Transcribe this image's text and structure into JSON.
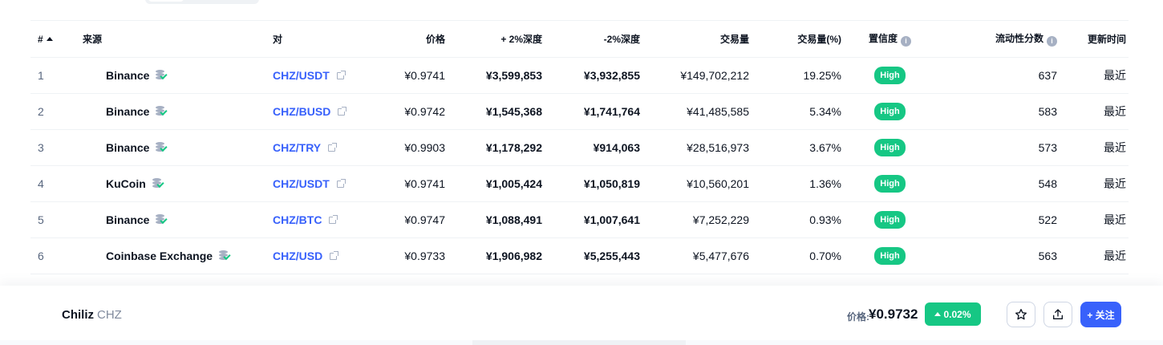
{
  "colors": {
    "accent": "#3861fb",
    "positive": "#16c784",
    "text_primary": "#0d1421",
    "text_secondary": "#58667e"
  },
  "table": {
    "headers": {
      "rank": "#",
      "source": "来源",
      "pair": "对",
      "price": "价格",
      "plus_depth": "+ 2%深度",
      "minus_depth": "-2%深度",
      "volume": "交易量",
      "volume_pct": "交易量(%)",
      "confidence": "置信度",
      "liquidity": "流动性分数",
      "updated": "更新时间"
    },
    "sort_icon": "sort-up-icon",
    "info_icon_glyph": "i",
    "rows": [
      {
        "rank": "1",
        "source": "Binance",
        "pair": "CHZ/USDT",
        "price": "¥0.9741",
        "plus_depth": "¥3,599,853",
        "minus_depth": "¥3,932,855",
        "volume": "¥149,702,212",
        "volume_pct": "19.25%",
        "confidence": "High",
        "liquidity": "637",
        "updated": "最近"
      },
      {
        "rank": "2",
        "source": "Binance",
        "pair": "CHZ/BUSD",
        "price": "¥0.9742",
        "plus_depth": "¥1,545,368",
        "minus_depth": "¥1,741,764",
        "volume": "¥41,485,585",
        "volume_pct": "5.34%",
        "confidence": "High",
        "liquidity": "583",
        "updated": "最近"
      },
      {
        "rank": "3",
        "source": "Binance",
        "pair": "CHZ/TRY",
        "price": "¥0.9903",
        "plus_depth": "¥1,178,292",
        "minus_depth": "¥914,063",
        "volume": "¥28,516,973",
        "volume_pct": "3.67%",
        "confidence": "High",
        "liquidity": "573",
        "updated": "最近"
      },
      {
        "rank": "4",
        "source": "KuCoin",
        "pair": "CHZ/USDT",
        "price": "¥0.9741",
        "plus_depth": "¥1,005,424",
        "minus_depth": "¥1,050,819",
        "volume": "¥10,560,201",
        "volume_pct": "1.36%",
        "confidence": "High",
        "liquidity": "548",
        "updated": "最近"
      },
      {
        "rank": "5",
        "source": "Binance",
        "pair": "CHZ/BTC",
        "price": "¥0.9747",
        "plus_depth": "¥1,088,491",
        "minus_depth": "¥1,007,641",
        "volume": "¥7,252,229",
        "volume_pct": "0.93%",
        "confidence": "High",
        "liquidity": "522",
        "updated": "最近"
      },
      {
        "rank": "6",
        "source": "Coinbase Exchange",
        "pair": "CHZ/USD",
        "price": "¥0.9733",
        "plus_depth": "¥1,906,982",
        "minus_depth": "¥5,255,443",
        "volume": "¥5,477,676",
        "volume_pct": "0.70%",
        "confidence": "High",
        "liquidity": "563",
        "updated": "最近"
      }
    ]
  },
  "bottom_bar": {
    "coin_name": "Chiliz",
    "coin_symbol": "CHZ",
    "price_label": "价格:",
    "price_value": "¥0.9732",
    "change": "0.02%",
    "follow_label": "+ 关注"
  }
}
